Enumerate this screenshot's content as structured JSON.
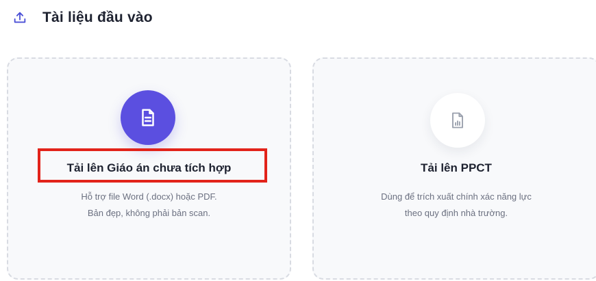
{
  "header": {
    "title": "Tài liệu đầu vào",
    "icon": "upload-icon"
  },
  "cards": [
    {
      "title": "Tải lên Giáo án chưa tích hợp",
      "desc_line1": "Hỗ trợ file Word (.docx) hoặc PDF.",
      "desc_line2": "Bản đẹp, không phải bản scan.",
      "icon": "document-icon",
      "icon_bg": "#5b4fe0",
      "highlight_color": "#e2231a"
    },
    {
      "title": "Tải lên PPCT",
      "desc_line1": "Dùng để trích xuất chính xác năng lực",
      "desc_line2": "theo quy định nhà trường.",
      "icon": "chart-document-icon",
      "icon_bg": "#ffffff"
    }
  ]
}
